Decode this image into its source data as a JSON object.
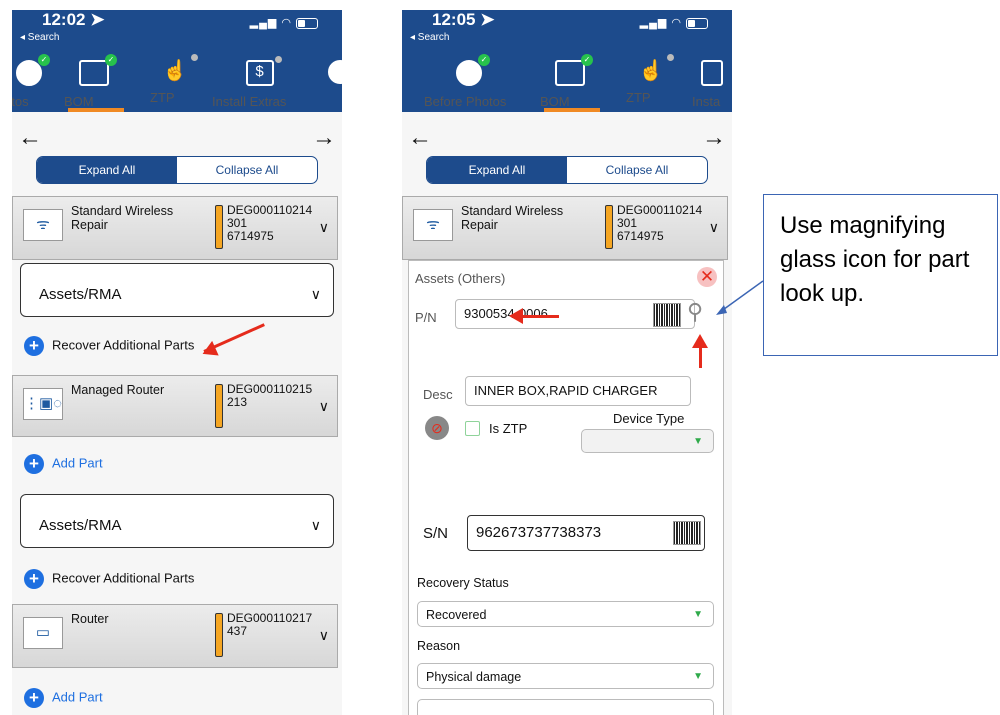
{
  "left_phone": {
    "status": {
      "time": "12:02 ➤",
      "back": "◂ Search"
    },
    "tabs": [
      {
        "label": "otos"
      },
      {
        "label": "BOM"
      },
      {
        "label": "ZTP"
      },
      {
        "label": "Install Extras"
      }
    ],
    "segment": {
      "expand": "Expand All",
      "collapse": "Collapse All"
    },
    "cards": [
      {
        "name": "Standard Wireless Repair",
        "id1": "DEG000110214",
        "id2": "301",
        "id3": "6714975"
      },
      {
        "name": "Managed Router",
        "id1": "DEG000110215",
        "id2": "213",
        "id3": ""
      },
      {
        "name": "Router",
        "id1": "DEG000110217",
        "id2": "437",
        "id3": ""
      }
    ],
    "assets_label": "Assets/RMA",
    "recover_label": "Recover Additional Parts",
    "add_part_label": "Add Part"
  },
  "right_phone": {
    "status": {
      "time": "12:05 ➤",
      "back": "◂ Search"
    },
    "tabs": [
      {
        "label": "Before Photos"
      },
      {
        "label": "BOM"
      },
      {
        "label": "ZTP"
      },
      {
        "label": "Insta"
      }
    ],
    "segment": {
      "expand": "Expand All",
      "collapse": "Collapse All"
    },
    "card": {
      "name": "Standard Wireless Repair",
      "id1": "DEG000110214",
      "id2": "301",
      "id3": "6714975"
    },
    "panel": {
      "title": "Assets (Others)",
      "pn_label": "P/N",
      "pn_value": "9300534-0006",
      "desc_label": "Desc",
      "desc_value": "INNER BOX,RAPID CHARGER",
      "is_ztp_label": "Is ZTP",
      "device_type_label": "Device Type",
      "sn_label": "S/N",
      "sn_value": "962673737738373",
      "recovery_status_label": "Recovery Status",
      "recovery_status_value": "Recovered",
      "reason_label": "Reason",
      "reason_value": "Physical damage"
    }
  },
  "callout": {
    "text": "Use magnifying glass icon for part look up."
  },
  "colors": {
    "header": "#1d4b8c",
    "accent": "#f08a24",
    "plus": "#1e6fe0",
    "annotation_red": "#e52b1c",
    "annotation_blue": "#3b65b4"
  }
}
